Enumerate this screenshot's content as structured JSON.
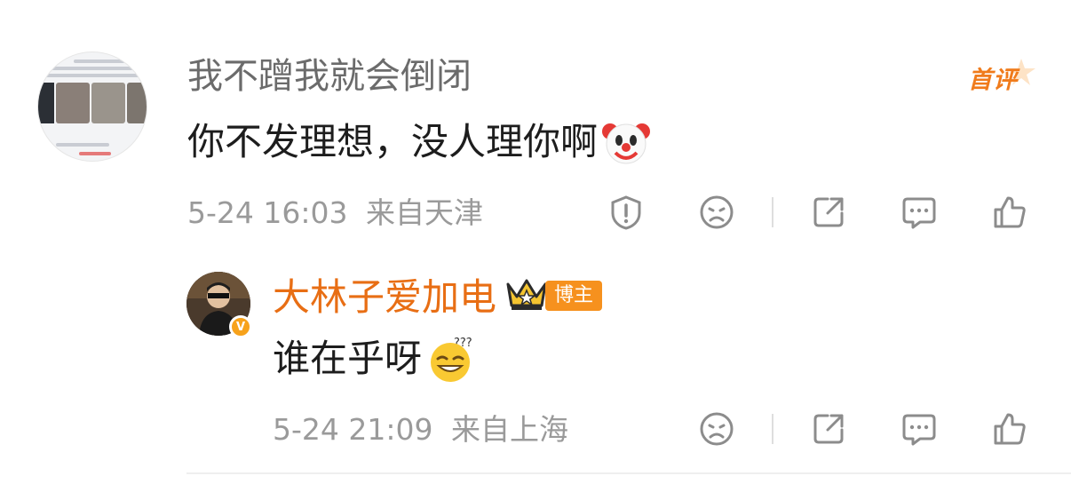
{
  "comment": {
    "author": "我不蹭我就会倒闭",
    "text": "你不发理想，没人理你啊",
    "emoji": "clown-face-emoji",
    "first_badge": "首评",
    "date": "5-24 16:03",
    "location": "来自天津",
    "actions": [
      "report-icon",
      "dislike-icon",
      "share-icon",
      "reply-icon",
      "like-icon"
    ]
  },
  "reply": {
    "author": "大林子爱加电",
    "author_badge": "博主",
    "crown_icon": "crown-icon",
    "verified_icon": "verified-v-icon",
    "text": "谁在乎呀",
    "emoji": "confused-grin-emoji",
    "date": "5-24 21:09",
    "location": "来自上海",
    "actions": [
      "dislike-icon",
      "share-icon",
      "reply-icon",
      "like-icon"
    ]
  },
  "colors": {
    "accent_orange": "#e86e14",
    "text_primary": "#1d1d1d",
    "text_secondary": "#6b6b6b",
    "meta_gray": "#9a9a9a",
    "icon_gray": "#8c8c8c",
    "badge_orange": "#f6911e",
    "verified_gold": "#f7a21b"
  }
}
